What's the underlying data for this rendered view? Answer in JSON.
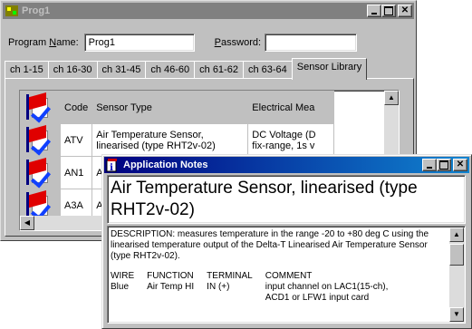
{
  "main_window": {
    "title": "Prog1",
    "program_name_label": "Program ",
    "program_name_accel": "N",
    "program_name_label_rest": "ame:",
    "program_name_value": "Prog1",
    "password_label_accel": "P",
    "password_label_rest": "assword:",
    "password_value": "",
    "tabs": [
      "ch 1-15",
      "ch 16-30",
      "ch 31-45",
      "ch 46-60",
      "ch 61-62",
      "ch 63-64",
      "Sensor Library"
    ],
    "active_tab": "Sensor Library",
    "grid": {
      "headers": [
        "Code",
        "Sensor Type",
        "Electrical Mea"
      ],
      "rows": [
        {
          "code": "ATV",
          "type": "Air Temperature Sensor, linearised (type RHT2v-02)",
          "electrical": "DC Voltage (D fix-range, 1s v"
        },
        {
          "code": "AN1",
          "type": "A",
          "electrical": ""
        },
        {
          "code": "A3A",
          "type": "A",
          "electrical": ""
        }
      ]
    }
  },
  "notes_window": {
    "title": "Application Notes",
    "heading": "Air Temperature Sensor, linearised (type RHT2v-02)",
    "description": "DESCRIPTION: measures temperature in the range -20 to +80 deg C using the linearised temperature output of the Delta-T Linearised Air Temperature Sensor (type RHT2v-02).",
    "wire_table": {
      "headers": [
        "WIRE",
        "FUNCTION",
        "TERMINAL",
        "COMMENT"
      ],
      "row": [
        "Blue",
        "Air Temp HI",
        "IN (+)",
        "input channel on LAC1(15-ch), ACD1 or LFW1 input card"
      ]
    }
  },
  "colors": {
    "active_title": "#000080",
    "inactive_title": "#808080",
    "face": "#c0c0c0",
    "flag_red": "#e00000",
    "check_blue": "#1040ff"
  }
}
